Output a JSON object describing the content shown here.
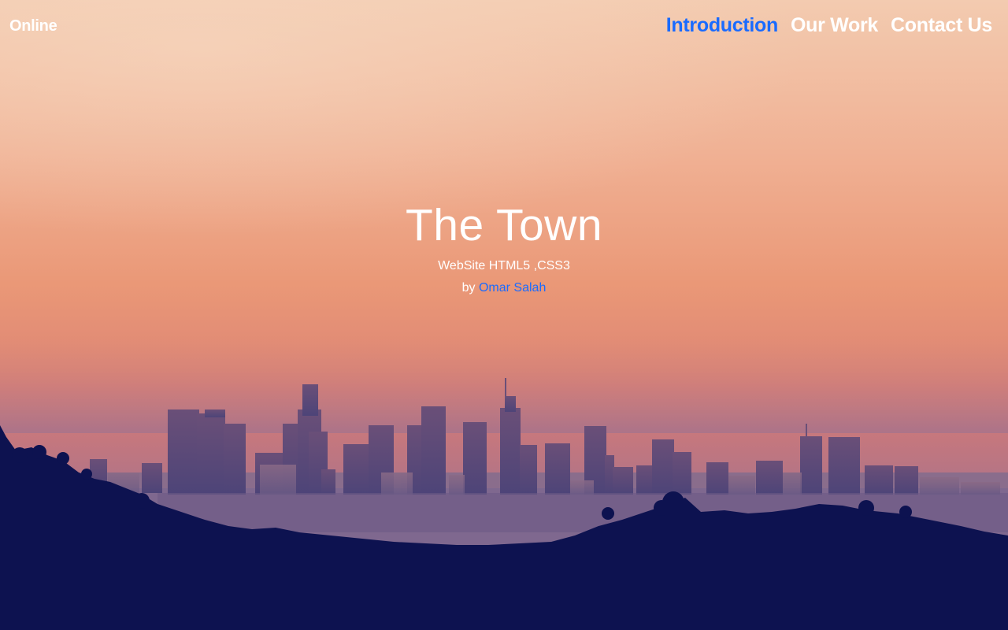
{
  "brand": {
    "name": "Online"
  },
  "nav": {
    "items": [
      {
        "label": "Introduction",
        "active": true
      },
      {
        "label": "Our Work",
        "active": false
      },
      {
        "label": "Contact Us",
        "active": false
      }
    ],
    "active_color": "#1a6bff"
  },
  "hero": {
    "title": "The Town",
    "subtitle": "WebSite HTML5 ,CSS3",
    "by_prefix": "by",
    "author": "Omar Salah"
  },
  "colors": {
    "sky_top": "#f0c6a8",
    "sky_mid": "#ec9a7a",
    "haze": "#c9797e",
    "hills": "#0d1250"
  }
}
